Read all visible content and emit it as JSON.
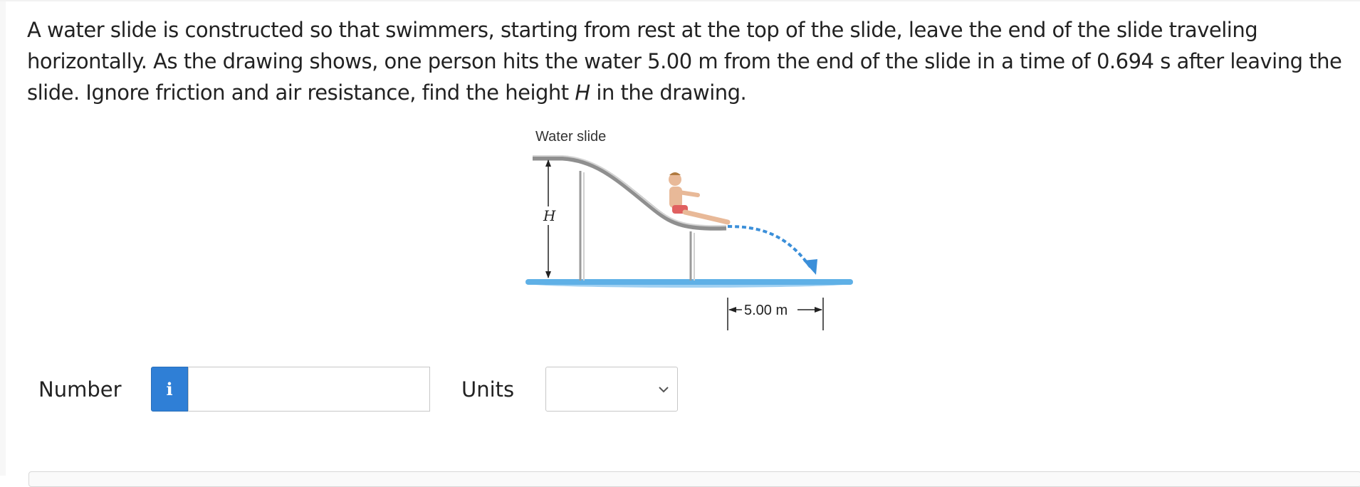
{
  "question": {
    "text_before_var": "A water slide is constructed so that swimmers, starting from rest at the top of the slide, leave the end of the slide traveling horizontally. As the drawing shows, one person hits the water 5.00 m from the end of the slide in a time of 0.694 s after leaving the slide. Ignore friction and air resistance, find the height ",
    "variable": "H",
    "text_after_var": " in the drawing."
  },
  "figure": {
    "title": "Water slide",
    "height_label": "H",
    "distance_label": "5.00 m"
  },
  "answer": {
    "number_label": "Number",
    "info_icon": "i",
    "number_value": "",
    "units_label": "Units",
    "units_value": ""
  },
  "colors": {
    "accent": "#2f7fd6",
    "water": "#5fb0e6",
    "trajectory": "#3b8fd9"
  }
}
